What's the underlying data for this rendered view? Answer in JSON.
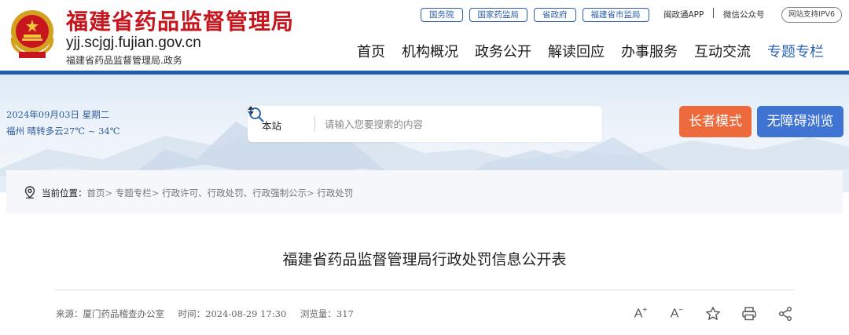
{
  "header": {
    "site_title": "福建省药品监督管理局",
    "site_domain": "yjj.scjgj.fujian.gov.cn",
    "site_subtitle": "福建省药品监督管理局.政务",
    "top_links": [
      "国务院",
      "国家药监局",
      "省政府",
      "福建省市监局"
    ],
    "app_link": "闽政通APP",
    "wechat_link": "微信公众号",
    "ipv6_badge": "网站支持IPV6",
    "nav": [
      "首页",
      "机构概况",
      "政务公开",
      "解读回应",
      "办事服务",
      "互动交流",
      "专题专栏"
    ],
    "active_nav": "专题专栏"
  },
  "banner": {
    "date": "2024年09月03日  星期二",
    "weather": "福州  晴转多云27℃ ~ 34℃",
    "search": {
      "scope": "本站",
      "placeholder": "请输入您要搜索的内容",
      "value": ""
    },
    "elder_mode": "长者模式",
    "accessible_mode": "无障碍浏览"
  },
  "breadcrumb": {
    "label": "当前位置：",
    "items": [
      "首页",
      "专题专栏",
      "行政许可、行政处罚、行政强制公示",
      "行政处罚"
    ],
    "separator": ">"
  },
  "article": {
    "title": "福建省药品监督管理局行政处罚信息公开表",
    "source": "来源：厦门药品稽查办公室",
    "time": "时间：2024-08-29 17:30",
    "views": "浏览量：317"
  },
  "tools": {
    "font_up": "A",
    "font_up_mark": "+",
    "font_down": "A",
    "font_down_mark": "−"
  },
  "colors": {
    "brand_red": "#c8161e",
    "nav_blue": "#1f5cae",
    "elder_orange": "#ec6a3b",
    "access_blue": "#3f74d2"
  }
}
